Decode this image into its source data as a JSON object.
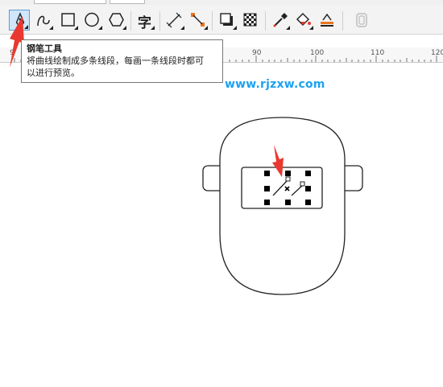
{
  "toolbar": {
    "tools": [
      {
        "name": "pen-tool",
        "icon": "pen-nib-icon",
        "active": true
      },
      {
        "name": "bspline-tool",
        "icon": "curve-icon"
      },
      {
        "name": "rectangle-tool",
        "icon": "rectangle-icon"
      },
      {
        "name": "ellipse-tool",
        "icon": "ellipse-icon"
      },
      {
        "name": "polygon-tool",
        "icon": "polygon-icon"
      },
      {
        "name": "text-tool",
        "icon": "text-icon",
        "label": "字"
      },
      {
        "name": "parallel-dimension-tool",
        "icon": "dimension-line-icon"
      },
      {
        "name": "connector-tool",
        "icon": "connector-icon"
      },
      {
        "name": "drop-shadow-tool",
        "icon": "drop-shadow-icon"
      },
      {
        "name": "transparency-tool",
        "icon": "checkerboard-icon"
      },
      {
        "name": "eyedropper-tool",
        "icon": "eyedropper-icon"
      },
      {
        "name": "interactive-fill-tool",
        "icon": "paint-bucket-icon"
      },
      {
        "name": "smart-fill-tool",
        "icon": "smart-fill-icon"
      },
      {
        "name": "disabled-tool",
        "icon": "rounded-rect-icon"
      }
    ]
  },
  "ruler": {
    "labels": [
      "90",
      "100",
      "110",
      "120"
    ],
    "left_partial": "9"
  },
  "tooltip": {
    "title": "钢笔工具",
    "line1": "将曲线绘制成多条线段，每画一条线段时都可",
    "line2": "以进行预览。"
  },
  "watermark": "www.rjzxw.com",
  "colors": {
    "accent": "#1da1f2",
    "arrow": "#e8382f",
    "active_tool_bg": "#cfe6fb"
  }
}
